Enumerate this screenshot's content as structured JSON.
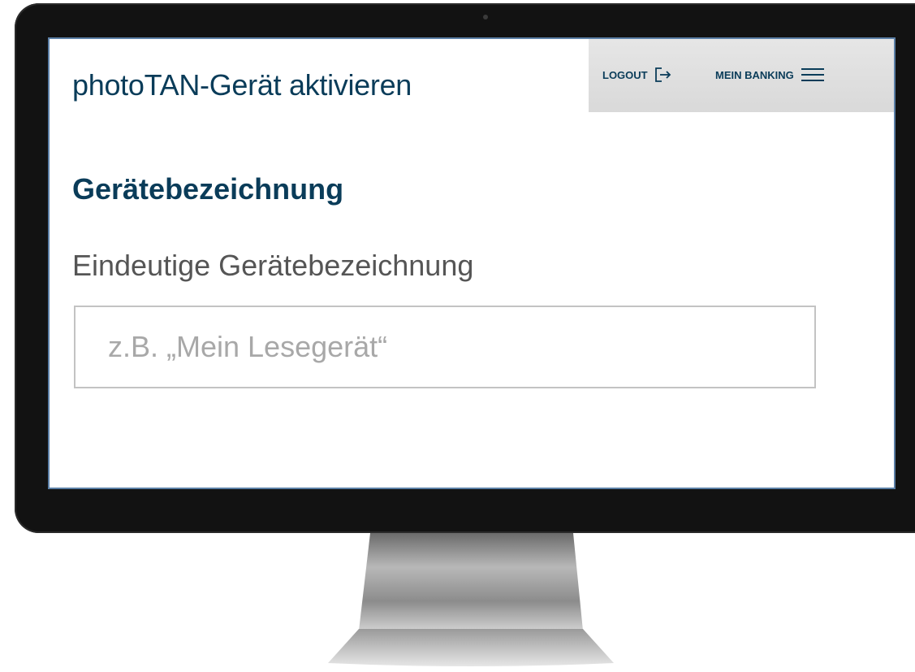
{
  "page": {
    "title": "photoTAN-Gerät aktivieren"
  },
  "nav": {
    "logout_label": "LOGOUT",
    "logout_icon": "logout-arrow-icon",
    "banking_label": "MEIN BANKING",
    "banking_icon": "hamburger-menu-icon"
  },
  "section": {
    "title": "Gerätebezeichnung"
  },
  "form": {
    "device_name_label": "Eindeutige Gerätebezeichnung",
    "device_name_placeholder": "z.B. „Mein Lesegerät“",
    "device_name_value": ""
  },
  "colors": {
    "brand_primary": "#0a3c59",
    "nav_background": "#dedede",
    "label_text": "#555555",
    "placeholder_text": "#a8a8a8",
    "input_border": "#c3c3c3"
  }
}
